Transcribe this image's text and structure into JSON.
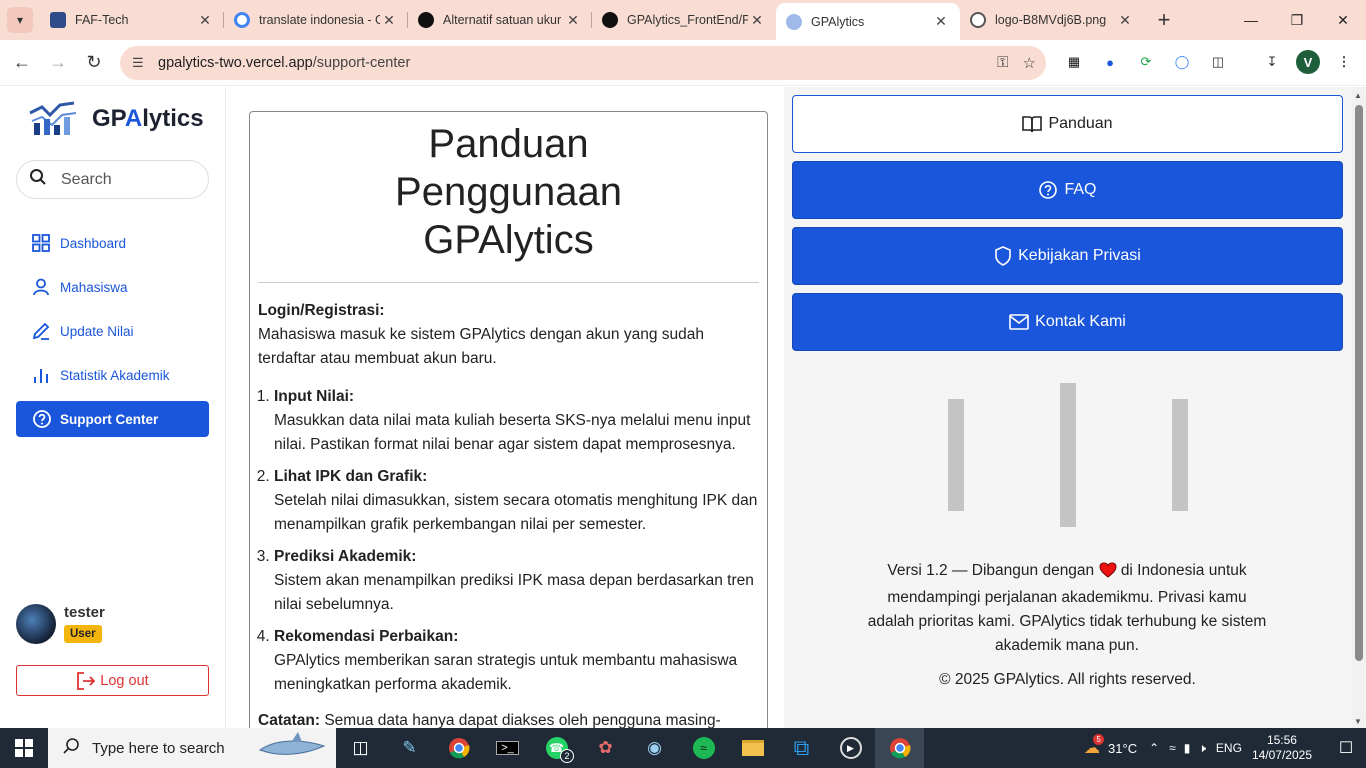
{
  "browser": {
    "tabs": [
      {
        "title": "FAF-Tech",
        "icon": "faf-tech-icon",
        "color": "#2e4b88",
        "active": false
      },
      {
        "title": "translate indonesia - G",
        "icon": "google-icon",
        "color": "#4285f4",
        "active": false
      },
      {
        "title": "Alternatif satuan ukur",
        "icon": "openai-icon",
        "color": "#111111",
        "active": false
      },
      {
        "title": "GPAlytics_FrontEnd/P",
        "icon": "github-icon",
        "color": "#111111",
        "active": false
      },
      {
        "title": "GPAlytics",
        "icon": "gpalytics-icon",
        "color": "#1a56db",
        "active": true
      },
      {
        "title": "logo-B8MVdj6B.png",
        "icon": "globe-icon",
        "color": "#555555",
        "active": false
      }
    ],
    "new_tab": "+",
    "url_host": "gpalytics-two.vercel.app",
    "url_path": "/support-center",
    "profile_initial": "V"
  },
  "sidebar": {
    "logo_prefix": "GP",
    "logo_accent": "A",
    "logo_suffix": "lytics",
    "search_placeholder": "Search",
    "nav": [
      {
        "label": "Dashboard",
        "icon": "grid-icon"
      },
      {
        "label": "Mahasiswa",
        "icon": "user-icon"
      },
      {
        "label": "Update Nilai",
        "icon": "pencil-icon"
      },
      {
        "label": "Statistik Akademik",
        "icon": "bar-chart-icon"
      },
      {
        "label": "Support Center",
        "icon": "help-circle-icon",
        "active": true
      }
    ],
    "user_name": "tester",
    "user_role": "User",
    "logout_label": "Log out"
  },
  "guide": {
    "title": "Panduan Penggunaan GPAlytics",
    "login_heading": "Login/Registrasi:",
    "login_text": "Mahasiswa masuk ke sistem GPAlytics dengan akun yang sudah terdaftar atau membuat akun baru.",
    "steps": [
      {
        "heading": "Input Nilai:",
        "text": "Masukkan data nilai mata kuliah beserta SKS-nya melalui menu input nilai. Pastikan format nilai benar agar sistem dapat memprosesnya."
      },
      {
        "heading": "Lihat IPK dan Grafik:",
        "text": "Setelah nilai dimasukkan, sistem secara otomatis menghitung IPK dan menampilkan grafik perkembangan nilai per semester."
      },
      {
        "heading": "Prediksi Akademik:",
        "text": "Sistem akan menampilkan prediksi IPK masa depan berdasarkan tren nilai sebelumnya."
      },
      {
        "heading": "Rekomendasi Perbaikan:",
        "text": "GPAlytics memberikan saran strategis untuk membantu mahasiswa meningkatkan performa akademik."
      }
    ],
    "note_heading": "Catatan:",
    "note_text": "Semua data hanya dapat diakses oleh pengguna masing-masing dan tidak tersinkronisasi dengan sistem akademik kampus."
  },
  "support_menu": {
    "panduan": "Panduan",
    "faq": "FAQ",
    "privacy": "Kebijakan Privasi",
    "contact": "Kontak Kami"
  },
  "footer": {
    "version_prefix": "Versi 1.2 — Dibangun dengan",
    "version_suffix": "di Indonesia untuk mendampingi perjalanan akademikmu. Privasi kamu adalah prioritas kami. GPAlytics tidak terhubung ke sistem akademik mana pun.",
    "copyright": "© 2025 GPAlytics. All rights reserved."
  },
  "taskbar": {
    "search_placeholder": "Type here to search",
    "whatsapp_badge": "2",
    "weather_badge": "5",
    "temperature": "31°C",
    "language": "ENG",
    "time": "15:56",
    "date": "14/07/2025"
  },
  "colors": {
    "primary": "#1a56db",
    "danger": "#dd3333",
    "badge": "#f3b50c",
    "tabstrip": "#f9ddd3"
  }
}
